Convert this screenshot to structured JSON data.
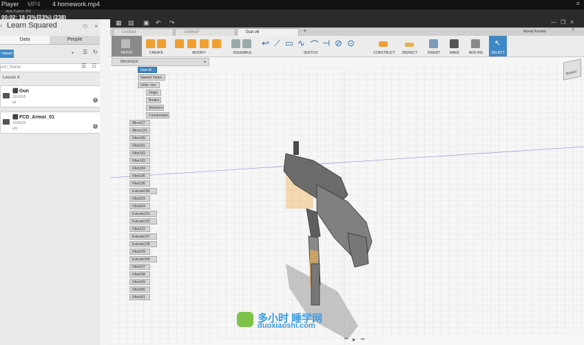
{
  "player": {
    "app": "Player",
    "format": "MP4",
    "file": "4 homework.mp4",
    "app_subtitle": "desk Fusion 360",
    "timestamp": "00:02: 18 (3%ㄖ3%) (238)"
  },
  "left_panel": {
    "project_title": "Learn Squared",
    "tabs": [
      "Data",
      "People"
    ],
    "upload_label": "Upload",
    "search_placeholder": "Name",
    "search_prefix": "ent",
    "folder_label": "Lesson 4",
    "items": [
      {
        "name": "Gun",
        "date": "10/15/15",
        "version": "v6"
      },
      {
        "name": "FCD_Armor_01",
        "date": "10/15/15",
        "version": "v31"
      }
    ]
  },
  "header": {
    "user": "Maciej Kuciara",
    "doc_tabs": [
      "Untitled",
      "Untitled*",
      "Gun v6"
    ]
  },
  "toolbar": {
    "groups": [
      "PATCH",
      "CREATE",
      "MODIFY",
      "ASSEMBLE",
      "SKETCH",
      "CONSTRUCT",
      "INSPECT",
      "INSERT",
      "MAKE",
      "ADD-INS",
      "SELECT"
    ],
    "accent": "#f0a030"
  },
  "browser": {
    "title": "BROWSER",
    "root": "Gun v6",
    "nodes": [
      "Named Views",
      "Units: mm",
      "Origin",
      "Bodies",
      "Sketches",
      "Construction"
    ],
    "timeline_items": [
      "Mirror57",
      "Mirror123",
      "Fillet180",
      "Fillet181",
      "Fillet182",
      "Fillet183",
      "Fillet184",
      "Fillet185",
      "Fillet186",
      "Extrude189",
      "Fillet203",
      "Fillet204",
      "Extrude231",
      "Extrude232",
      "Fillet233",
      "Extrude237",
      "Extrude238",
      "Fillet239",
      "Extrude294",
      "Fillet297",
      "Fillet298",
      "Fillet299",
      "Fillet300",
      "Fillet301"
    ]
  },
  "viewcube": {
    "label": "RIGHT"
  },
  "watermark": {
    "cn": "多小时 睡学网",
    "url": "duoxiaoshi.com"
  }
}
